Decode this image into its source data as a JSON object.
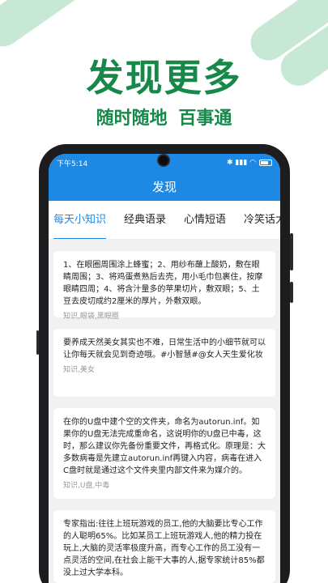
{
  "promo": {
    "headline": "发现更多",
    "subline": "随时随地  百事通"
  },
  "statusbar": {
    "time": "下午5:14",
    "icons": "✱ ▮▮▮ ◠ "
  },
  "appbar": {
    "title": "发现"
  },
  "tabs": [
    {
      "label": "每天小知识",
      "active": true
    },
    {
      "label": "经典语录"
    },
    {
      "label": "心情短语"
    },
    {
      "label": "冷笑话大"
    }
  ],
  "cards": [
    {
      "text": "1、在眼圈周围涂上蜂蜜；2、用纱布蘸上酸奶，敷在眼睛周围；3、将鸡蛋煮熟后去壳，用小毛巾包裹住，按摩眼睛四周；4、将含汁量多的苹果切片，敷双眼；5、土豆去皮切成约2厘米的厚片，外敷双眼。",
      "tags": "知识,眼袋,黑眼圈"
    },
    {
      "text": "要养成天然美女其实也不难，日常生活中的小细节就可以让你每天就会见到奇迹哦。#小智慧#@女人天生爱化妆",
      "tags": "知识,美女"
    },
    {
      "text": "在你的U盘中建个空的文件夹，命名为autorun.inf。如果你的U盘无法完成重命名，这说明你的U盘已中毒，这时，那么建议你先备份重要文件，再格式化。原理是：大多数病毒是先建立autorun.inf再键入内容，病毒在进入C盘时就是通过这个文件夹里内部文件来为媒介的。",
      "tags": "知识,U盘,中毒"
    },
    {
      "text": "专家指出:往往上班玩游戏的员工,他的大脑要比专心工作的人聪明65%。比如某员工上班玩游戏人,他的精力投在玩上,大脑的灵活率极度升高，而专心工作的员工没有一点灵活的空间,在社会上能干大事的人,据专家统计85%都没上过大学本科。",
      "tags": ""
    }
  ]
}
